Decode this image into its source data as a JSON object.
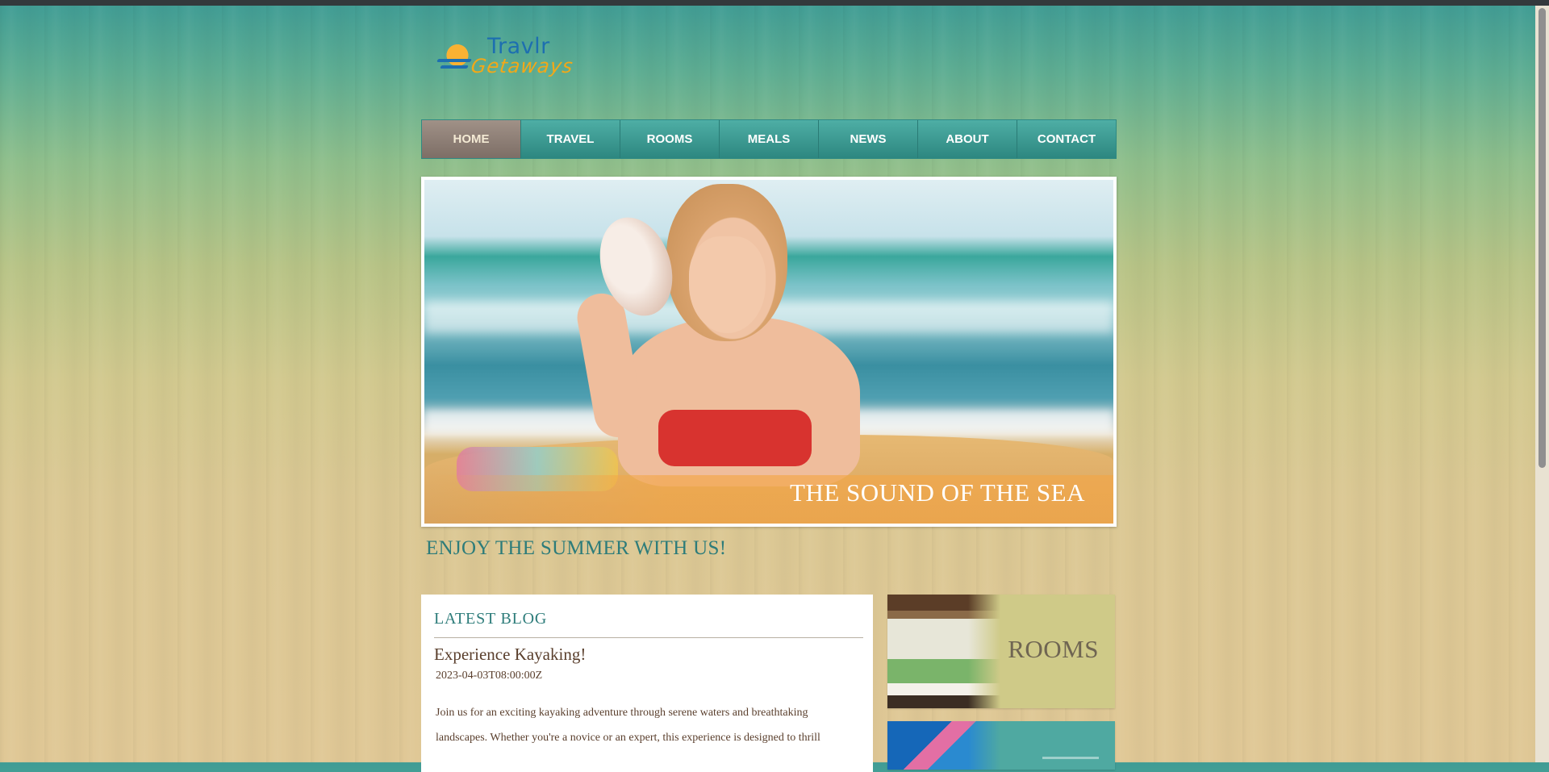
{
  "brand": {
    "name_line1": "Travlr",
    "name_line2": "Getaways"
  },
  "nav": {
    "items": [
      {
        "label": "HOME",
        "active": true
      },
      {
        "label": "TRAVEL"
      },
      {
        "label": "ROOMS"
      },
      {
        "label": "MEALS"
      },
      {
        "label": "NEWS"
      },
      {
        "label": "ABOUT"
      },
      {
        "label": "CONTACT"
      }
    ]
  },
  "hero": {
    "caption": "THE SOUND OF THE SEA"
  },
  "tagline": "ENJOY THE SUMMER WITH US!",
  "blog": {
    "heading": "LATEST BLOG",
    "post": {
      "title": "Experience Kayaking!",
      "date": "2023-04-03T08:00:00Z",
      "excerpt": "Join us for an exciting kayaking adventure through serene waters and breathtaking landscapes. Whether you're a novice or an expert, this experience is designed to thrill"
    }
  },
  "sidebar": {
    "cards": [
      {
        "label": "ROOMS"
      }
    ]
  },
  "colors": {
    "nav_teal": "#2d8780",
    "nav_active": "#8f8077",
    "heading_teal": "#2d7c7a",
    "text_brown": "#5a3f2d",
    "rooms_card": "#cfca88"
  }
}
